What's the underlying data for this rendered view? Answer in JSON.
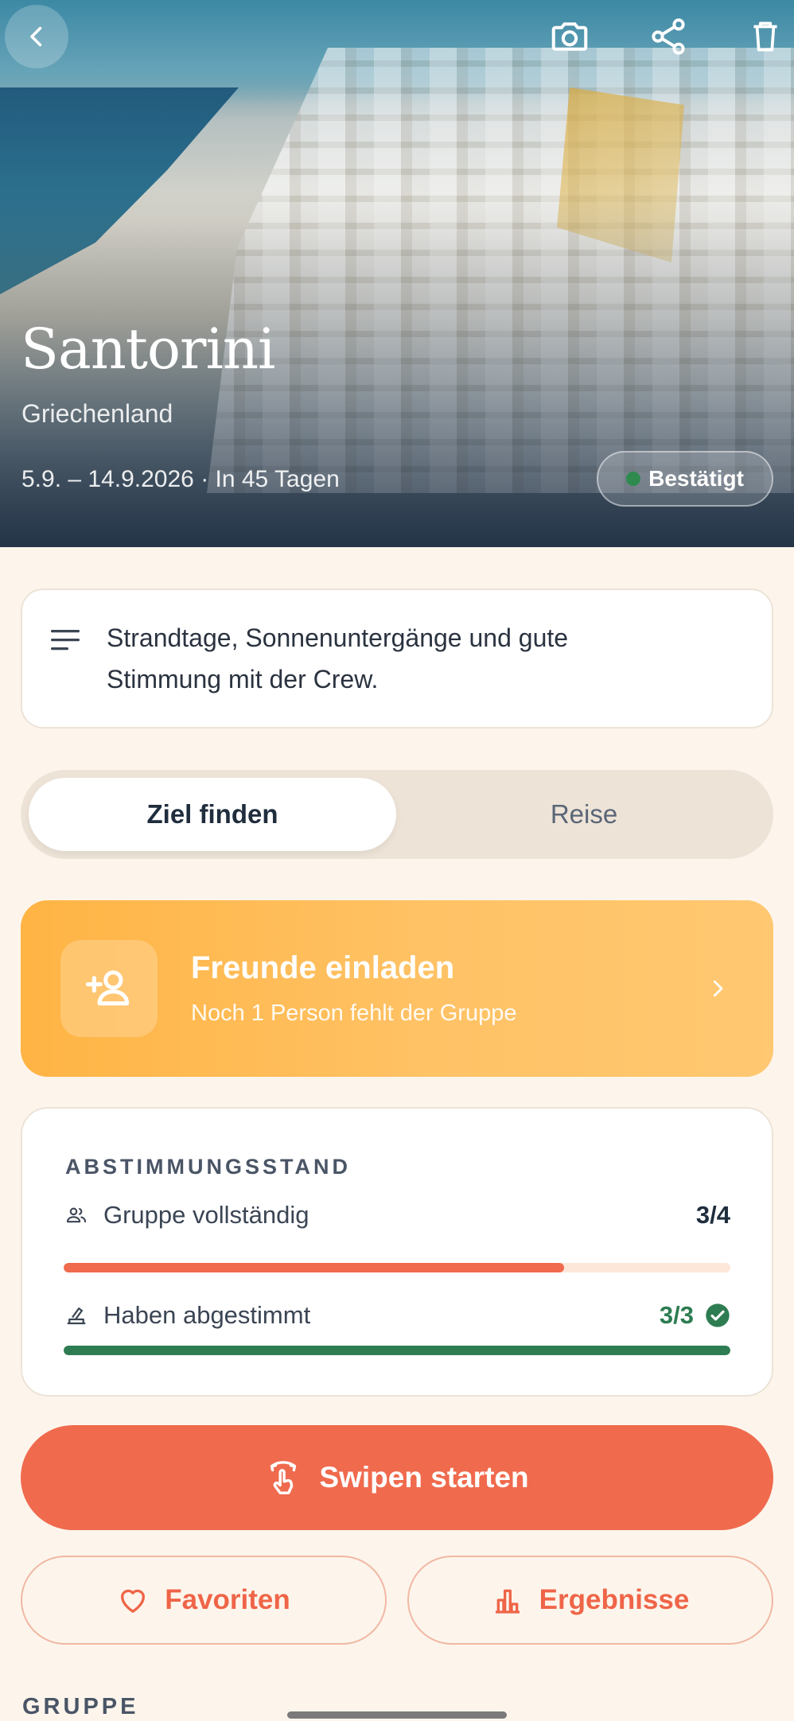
{
  "hero": {
    "title": "Santorini",
    "country": "Griechenland",
    "dates": "5.9. – 14.9.2026 · In 45 Tagen",
    "status": "Bestätigt",
    "status_color": "#2f8a4f",
    "icons": [
      "chevron-left-icon",
      "camera-icon",
      "share-icon",
      "trash-icon"
    ]
  },
  "description": {
    "icon": "notes-icon",
    "text_line1": "Strandtage, Sonnenuntergänge und gute",
    "text_line2": "Stimmung mit der Crew."
  },
  "tabs": {
    "active": "Ziel finden",
    "inactive": "Reise"
  },
  "invite": {
    "title": "Freunde einladen",
    "subtitle": "Noch 1 Person fehlt der Gruppe",
    "icon": "person-add-icon"
  },
  "vote": {
    "heading": "ABSTIMMUNGSSTAND",
    "rows": [
      {
        "label": "Gruppe vollständig",
        "value": "3/4",
        "progress": 0.75,
        "color": "#f06a4d",
        "icon": "group-icon"
      },
      {
        "label": "Haben abgestimmt",
        "value": "3/3",
        "progress": 1.0,
        "color": "#2e7d52",
        "icon": "ballot-icon"
      }
    ]
  },
  "actions": {
    "swipe": "Swipen starten",
    "favorites": "Favoriten",
    "results": "Ergebnisse"
  },
  "section": {
    "group_heading": "GRUPPE"
  },
  "colors": {
    "accent": "#f06a4d",
    "invite": "#ffb444",
    "background": "#fdf5ec",
    "success": "#2e7d52"
  }
}
